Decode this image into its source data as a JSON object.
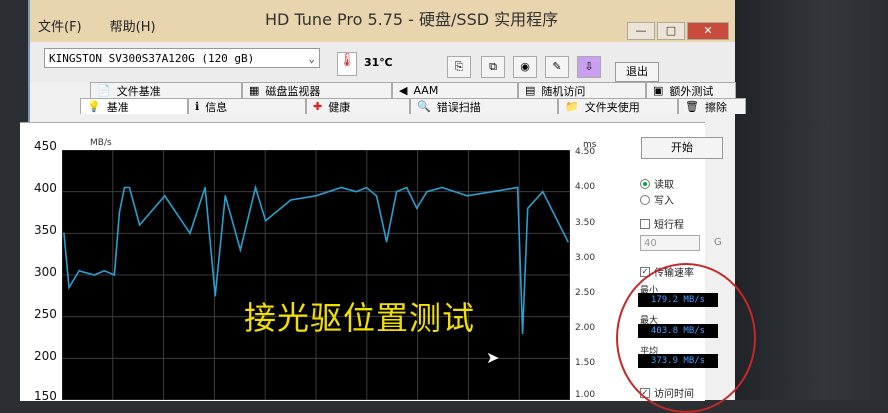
{
  "window": {
    "title": "HD Tune Pro 5.75 - 硬盘/SSD 实用程序",
    "menu": [
      "文件(F)",
      "帮助(H)"
    ],
    "controls": [
      "—",
      "□",
      "✕"
    ]
  },
  "toolbar": {
    "drive": "KINGSTON SV300S37A120G (120 gB)",
    "temperature": "31℃",
    "exit_label": "退出"
  },
  "tabs": {
    "row1": [
      "文件基准",
      "磁盘监视器",
      "AAM",
      "随机访问",
      "额外测试"
    ],
    "row2": [
      "基准",
      "信息",
      "健康",
      "错误扫描",
      "文件夹使用",
      "擦除"
    ]
  },
  "chart_data": {
    "type": "line",
    "yunit_left": "MB/s",
    "yunit_right": "ms",
    "yticks_left": [
      "450",
      "400",
      "350",
      "300",
      "250",
      "200",
      "150"
    ],
    "yticks_right": [
      "4.50",
      "4.00",
      "3.50",
      "3.00",
      "2.50",
      "2.00",
      "1.50",
      "1.00"
    ],
    "ylim": [
      150,
      450
    ],
    "series": [
      {
        "color": "#2a9fd0",
        "x": [
          0,
          1,
          3,
          6,
          8,
          10,
          11,
          12,
          13,
          15,
          20,
          25,
          28,
          30,
          32,
          35,
          38,
          40,
          45,
          50,
          55,
          58,
          60,
          62,
          64,
          66,
          68,
          70,
          72,
          75,
          80,
          85,
          90,
          91,
          92,
          95,
          100
        ],
        "values": [
          350,
          285,
          305,
          300,
          305,
          300,
          375,
          405,
          405,
          360,
          395,
          350,
          405,
          275,
          395,
          330,
          405,
          365,
          390,
          395,
          405,
          400,
          405,
          395,
          340,
          400,
          405,
          380,
          400,
          405,
          395,
          400,
          405,
          230,
          380,
          400,
          340
        ]
      }
    ]
  },
  "overlay_text": "接光驱位置测试",
  "right_panel": {
    "start_label": "开始",
    "read_label": "读取",
    "write_label": "写入",
    "short_stroke_label": "短行程",
    "short_stroke_value": "40",
    "short_stroke_unit": "G",
    "transfer_rate_label": "传输速率",
    "min_label": "最小",
    "min_value": "179.2 MB/s",
    "max_label": "最大",
    "max_value": "403.8 MB/s",
    "avg_label": "平均",
    "avg_value": "373.9 MB/s",
    "access_time_label": "访问时间"
  }
}
